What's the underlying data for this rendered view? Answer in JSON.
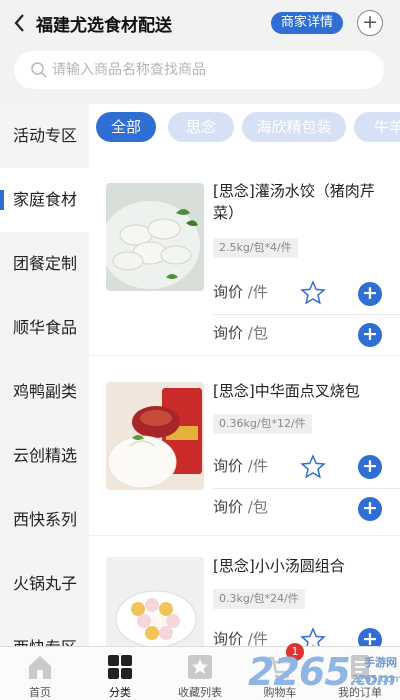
{
  "header": {
    "back_icon": "chevron-left-icon",
    "title": "福建尤选食材配送",
    "detail_button": "商家详情",
    "more_icon": "plus-circle-icon"
  },
  "search": {
    "placeholder": "请输入商品名称查找商品",
    "value": "",
    "icon": "search-icon"
  },
  "sidebar": {
    "items": [
      {
        "label": "活动专区"
      },
      {
        "label": "家庭食材",
        "active": true
      },
      {
        "label": "团餐定制"
      },
      {
        "label": "顺华食品"
      },
      {
        "label": "鸡鸭副类"
      },
      {
        "label": "云创精选"
      },
      {
        "label": "西快系列"
      },
      {
        "label": "火锅丸子"
      },
      {
        "label": "西快专区"
      }
    ]
  },
  "filters": {
    "chips": [
      {
        "label": "全部",
        "active": true
      },
      {
        "label": "思念"
      },
      {
        "label": "海欣精包装"
      },
      {
        "label": "牛羊"
      }
    ]
  },
  "products": [
    {
      "name": "[思念]灌汤水饺（猪肉芹菜）",
      "spec": "2.5kg/包*4/件",
      "prices": [
        {
          "label": "询价",
          "unit": "/件"
        },
        {
          "label": "询价",
          "unit": "/包"
        }
      ]
    },
    {
      "name": "[思念]中华面点叉烧包",
      "spec": "0.36kg/包*12/件",
      "prices": [
        {
          "label": "询价",
          "unit": "/件"
        },
        {
          "label": "询价",
          "unit": "/包"
        }
      ]
    },
    {
      "name": "[思念]小小汤圆组合",
      "spec": "0.3kg/包*24/件",
      "prices": [
        {
          "label": "询价",
          "unit": "/件"
        }
      ]
    }
  ],
  "tabbar": {
    "items": [
      {
        "label": "首页",
        "icon": "home-icon"
      },
      {
        "label": "分类",
        "icon": "grid-icon",
        "active": true
      },
      {
        "label": "收藏列表",
        "icon": "star-box-icon"
      },
      {
        "label": "购物车",
        "icon": "cart-icon",
        "badge": "1"
      },
      {
        "label": "我的订单",
        "icon": "order-icon"
      }
    ]
  },
  "watermark": {
    "main": "2265",
    "suffix": ".com",
    "sub1": "手游网",
    "sub2": "2265.com"
  },
  "colors": {
    "accent": "#2f6fd4",
    "chip_inactive": "#d6e1f6",
    "badge": "#e0322f"
  }
}
